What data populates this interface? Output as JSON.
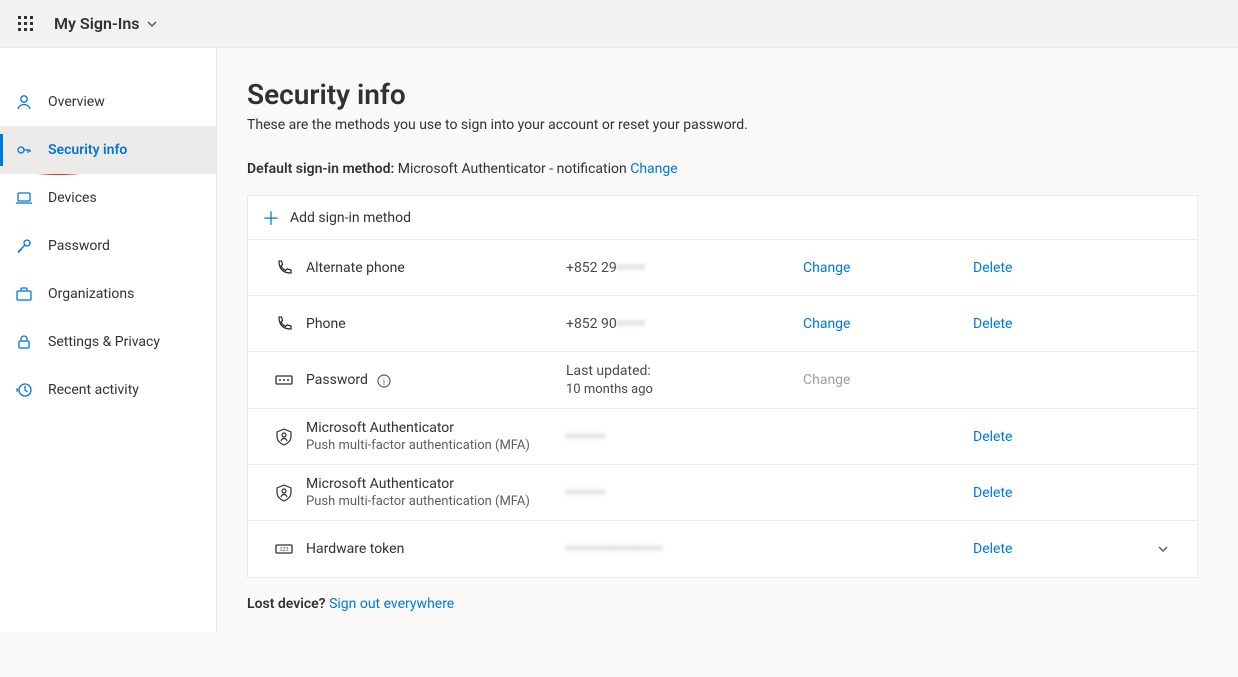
{
  "header": {
    "app_title": "My Sign-Ins"
  },
  "sidebar": {
    "items": [
      {
        "label": "Overview"
      },
      {
        "label": "Security info"
      },
      {
        "label": "Devices"
      },
      {
        "label": "Password"
      },
      {
        "label": "Organizations"
      },
      {
        "label": "Settings & Privacy"
      },
      {
        "label": "Recent activity"
      }
    ]
  },
  "main": {
    "title": "Security info",
    "subtitle": "These are the methods you use to sign into your account or reset your password.",
    "default_label": "Default sign-in method:",
    "default_value": "Microsoft Authenticator - notification",
    "change_link": "Change",
    "add_method_label": "Add sign-in method",
    "methods": [
      {
        "name": "Alternate phone",
        "sub": "",
        "value_prefix": "+852 29",
        "value_blur": "•••••",
        "change": "Change",
        "delete": "Delete",
        "change_enabled": true,
        "show_expand": false
      },
      {
        "name": "Phone",
        "sub": "",
        "value_prefix": "+852 90",
        "value_blur": "•••••",
        "change": "Change",
        "delete": "Delete",
        "change_enabled": true,
        "show_expand": false
      },
      {
        "name": "Password",
        "sub": "",
        "value_line1": "Last updated:",
        "value_line2": "10 months ago",
        "change": "Change",
        "delete": "",
        "change_enabled": false,
        "show_expand": false,
        "show_info": true
      },
      {
        "name": "Microsoft Authenticator",
        "sub": "Push multi-factor authentication (MFA)",
        "value_blur": "•••••••",
        "change": "",
        "delete": "Delete",
        "change_enabled": false,
        "show_expand": false
      },
      {
        "name": "Microsoft Authenticator",
        "sub": "Push multi-factor authentication (MFA)",
        "value_blur": "•••••••",
        "change": "",
        "delete": "Delete",
        "change_enabled": false,
        "show_expand": false
      },
      {
        "name": "Hardware token",
        "sub": "",
        "value_blur": "•••••••••••••••••",
        "change": "",
        "delete": "Delete",
        "change_enabled": false,
        "show_expand": true
      }
    ],
    "lost_device_q": "Lost device?",
    "sign_out_label": "Sign out everywhere"
  }
}
